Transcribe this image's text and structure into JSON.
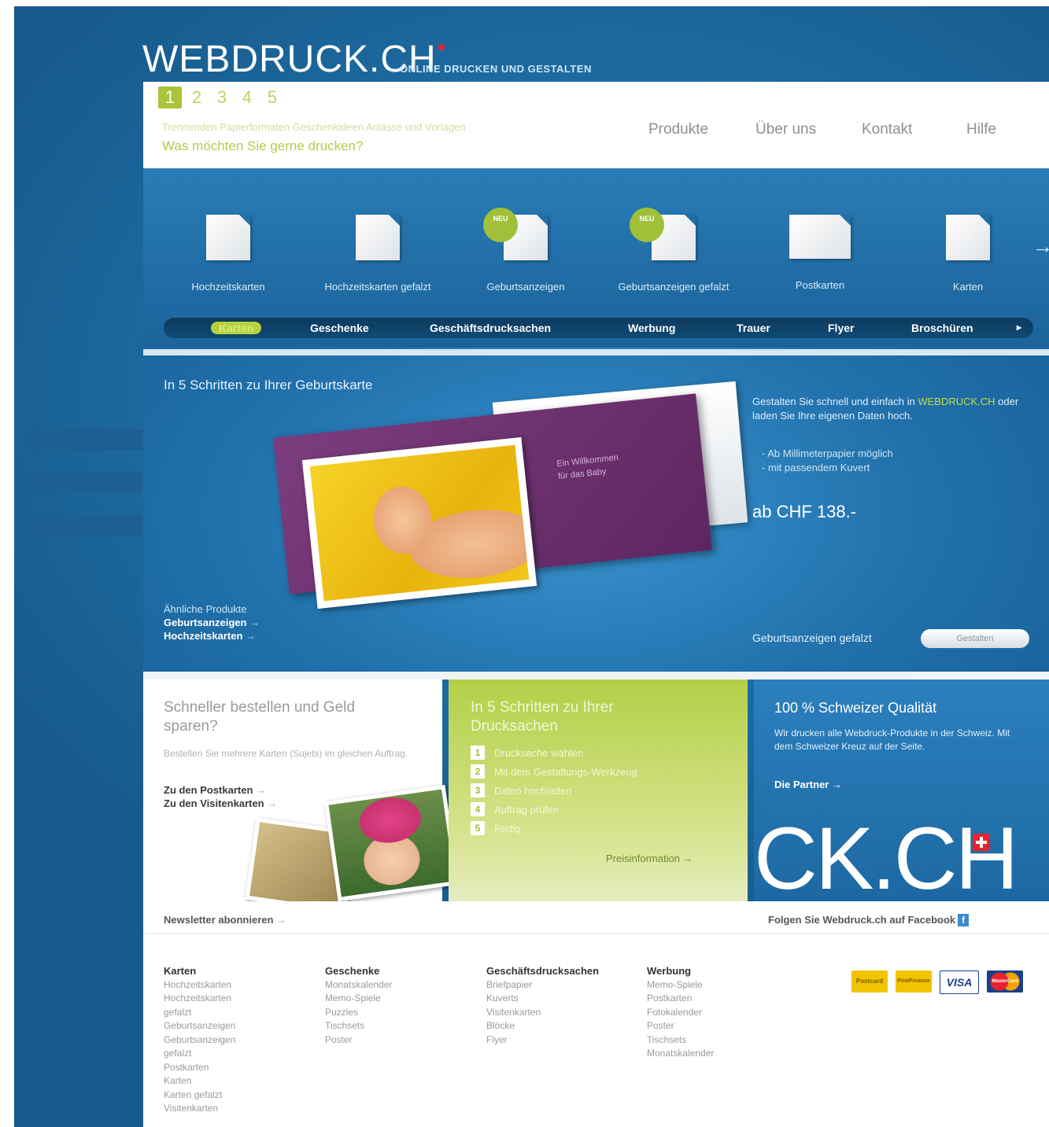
{
  "header": {
    "logo": "WEBDRUCK.CH",
    "tagline": "ONLINE DRUCKEN UND GESTALTEN",
    "steps": [
      "1",
      "2",
      "3",
      "4",
      "5"
    ],
    "step_description": "Trennenden Papierformaten Geschenkideen Anlässe und Vorlagen",
    "question": "Was möchten Sie gerne drucken?",
    "nav": [
      "Produkte",
      "Über uns",
      "Kontakt",
      "Hilfe"
    ]
  },
  "products": [
    {
      "label": "Hochzeitskarten"
    },
    {
      "label": "Hochzeitskarten gefalzt"
    },
    {
      "label": "Geburtsanzeigen",
      "badge": "NEU"
    },
    {
      "label": "Geburtsanzeigen gefalzt",
      "badge": "NEU"
    },
    {
      "label": "Postkarten"
    },
    {
      "label": "Karten"
    }
  ],
  "categories": [
    "Karten",
    "Geschenke",
    "Geschäftsdrucksachen",
    "Werbung",
    "Trauer",
    "Flyer",
    "Broschüren"
  ],
  "hero": {
    "title": "In 5 Schritten zu Ihrer Geburtskarte",
    "info_prefix": "Gestalten Sie schnell und einfach in",
    "info_highlight": "WEBDRUCK.CH",
    "info_suffix": "oder laden Sie Ihre eigenen Daten hoch.",
    "bullet1": "- Ab Millimeterpapier möglich",
    "bullet2": "- mit passendem Kuvert",
    "price": "ab CHF 138.-",
    "card_line1": "Ein Willkommen",
    "card_line2": "für das Baby",
    "similar_label": "Ähnliche Produkte",
    "similar_link1": "Geburtsanzeigen",
    "similar_link2": "Hochzeitskarten",
    "button_label": "Geburtsanzeigen gefalzt",
    "button_text": "Gestalten"
  },
  "box1": {
    "title": "Schneller bestellen und Geld sparen?",
    "text": "Bestellen Sie mehrere Karten (Sujets) im gleichen Auftrag.",
    "link1": "Zu den Postkarten",
    "link2": "Zu den Visitenkarten"
  },
  "box2": {
    "title": "In 5 Schritten zu Ihrer Drucksachen",
    "steps": [
      "Drucksache wählen",
      "Mit dem Gestaltungs-Werkzeug",
      "Daten hochladen",
      "Auftrag prüfen",
      "Fertig"
    ],
    "link": "Preisinformation"
  },
  "box3": {
    "title": "100 % Schweizer Qualität",
    "text": "Wir drucken alle Webdruck-Produkte in der Schweiz. Mit dem Schweizer Kreuz auf der Seite.",
    "link": "Die Partner",
    "bigtext": "CK.CH"
  },
  "footer": {
    "newsletter": "Newsletter abonnieren",
    "facebook": "Folgen Sie Webdruck.ch auf Facebook",
    "facebook_icon": "f",
    "columns": [
      {
        "heading": "Karten",
        "items": [
          "Hochzeitskarten",
          "Hochzeitskarten",
          "gefalzt",
          "Geburtsanzeigen",
          "Geburtsanzeigen",
          "gefalzt",
          "Postkarten",
          "Karten",
          "Karten gefalzt",
          "Visitenkarten"
        ]
      },
      {
        "heading": "Geschenke",
        "items": [
          "Monatskalender",
          "Memo-Spiele",
          "Puzzles",
          "Tischsets",
          "Poster"
        ]
      },
      {
        "heading": "Geschäftsdrucksachen",
        "items": [
          "Briefpapier",
          "Kuverts",
          "Visitenkarten",
          "Blöcke",
          "Flyer"
        ]
      },
      {
        "heading": "Werbung",
        "items": [
          "Memo-Spiele",
          "Postkarten",
          "Fotokalender",
          "Poster",
          "Tischsets",
          "Monatskalender"
        ]
      }
    ],
    "payments": [
      "Postcard",
      "PostFinance",
      "VISA",
      "MasterCard"
    ]
  },
  "colors": {
    "brand_blue": "#1f6fa8",
    "accent_green": "#9fc038",
    "swiss_red": "#e8232e"
  }
}
